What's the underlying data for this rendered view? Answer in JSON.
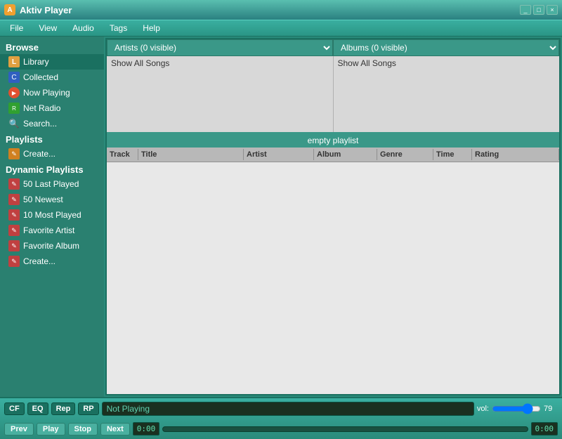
{
  "titleBar": {
    "icon": "A",
    "title": "Aktiv Player",
    "controls": [
      "_",
      "□",
      "×"
    ]
  },
  "menuBar": {
    "items": [
      "File",
      "View",
      "Audio",
      "Tags",
      "Help"
    ]
  },
  "sidebar": {
    "browseSectionTitle": "Browse",
    "browseItems": [
      {
        "label": "Library",
        "icon": "lib",
        "active": true
      },
      {
        "label": "Collected",
        "icon": "col"
      },
      {
        "label": "Now Playing",
        "icon": "np"
      },
      {
        "label": "Net Radio",
        "icon": "nr"
      },
      {
        "label": "Search...",
        "icon": "search"
      }
    ],
    "playlistSectionTitle": "Playlists",
    "playlistItems": [
      {
        "label": "Create...",
        "icon": "pl"
      }
    ],
    "dynamicSectionTitle": "Dynamic Playlists",
    "dynamicItems": [
      {
        "label": "50 Last Played",
        "icon": "dp"
      },
      {
        "label": "50 Newest",
        "icon": "dp"
      },
      {
        "label": "10 Most Played",
        "icon": "dp"
      },
      {
        "label": "Favorite Artist",
        "icon": "dp"
      },
      {
        "label": "Favorite Album",
        "icon": "dp"
      },
      {
        "label": "Create...",
        "icon": "dp"
      }
    ]
  },
  "content": {
    "artistsDropdown": "Artists (0 visible)",
    "albumsDropdown": "Albums (0 visible)",
    "artistShowAll": "Show All Songs",
    "albumShowAll": "Show All Songs",
    "playlistLabel": "empty playlist",
    "columns": [
      "Track",
      "Title",
      "Artist",
      "Album",
      "Genre",
      "Time",
      "Rating"
    ],
    "tracks": []
  },
  "bottomBar": {
    "modeButtons": [
      "CF",
      "EQ",
      "Rep",
      "RP"
    ],
    "nowPlayingText": "Not Playing",
    "volLabel": "vol:",
    "volValue": "79",
    "transportButtons": [
      "Prev",
      "Play",
      "Stop",
      "Next"
    ],
    "timeStart": "0:00",
    "timeEnd": "0:00"
  }
}
